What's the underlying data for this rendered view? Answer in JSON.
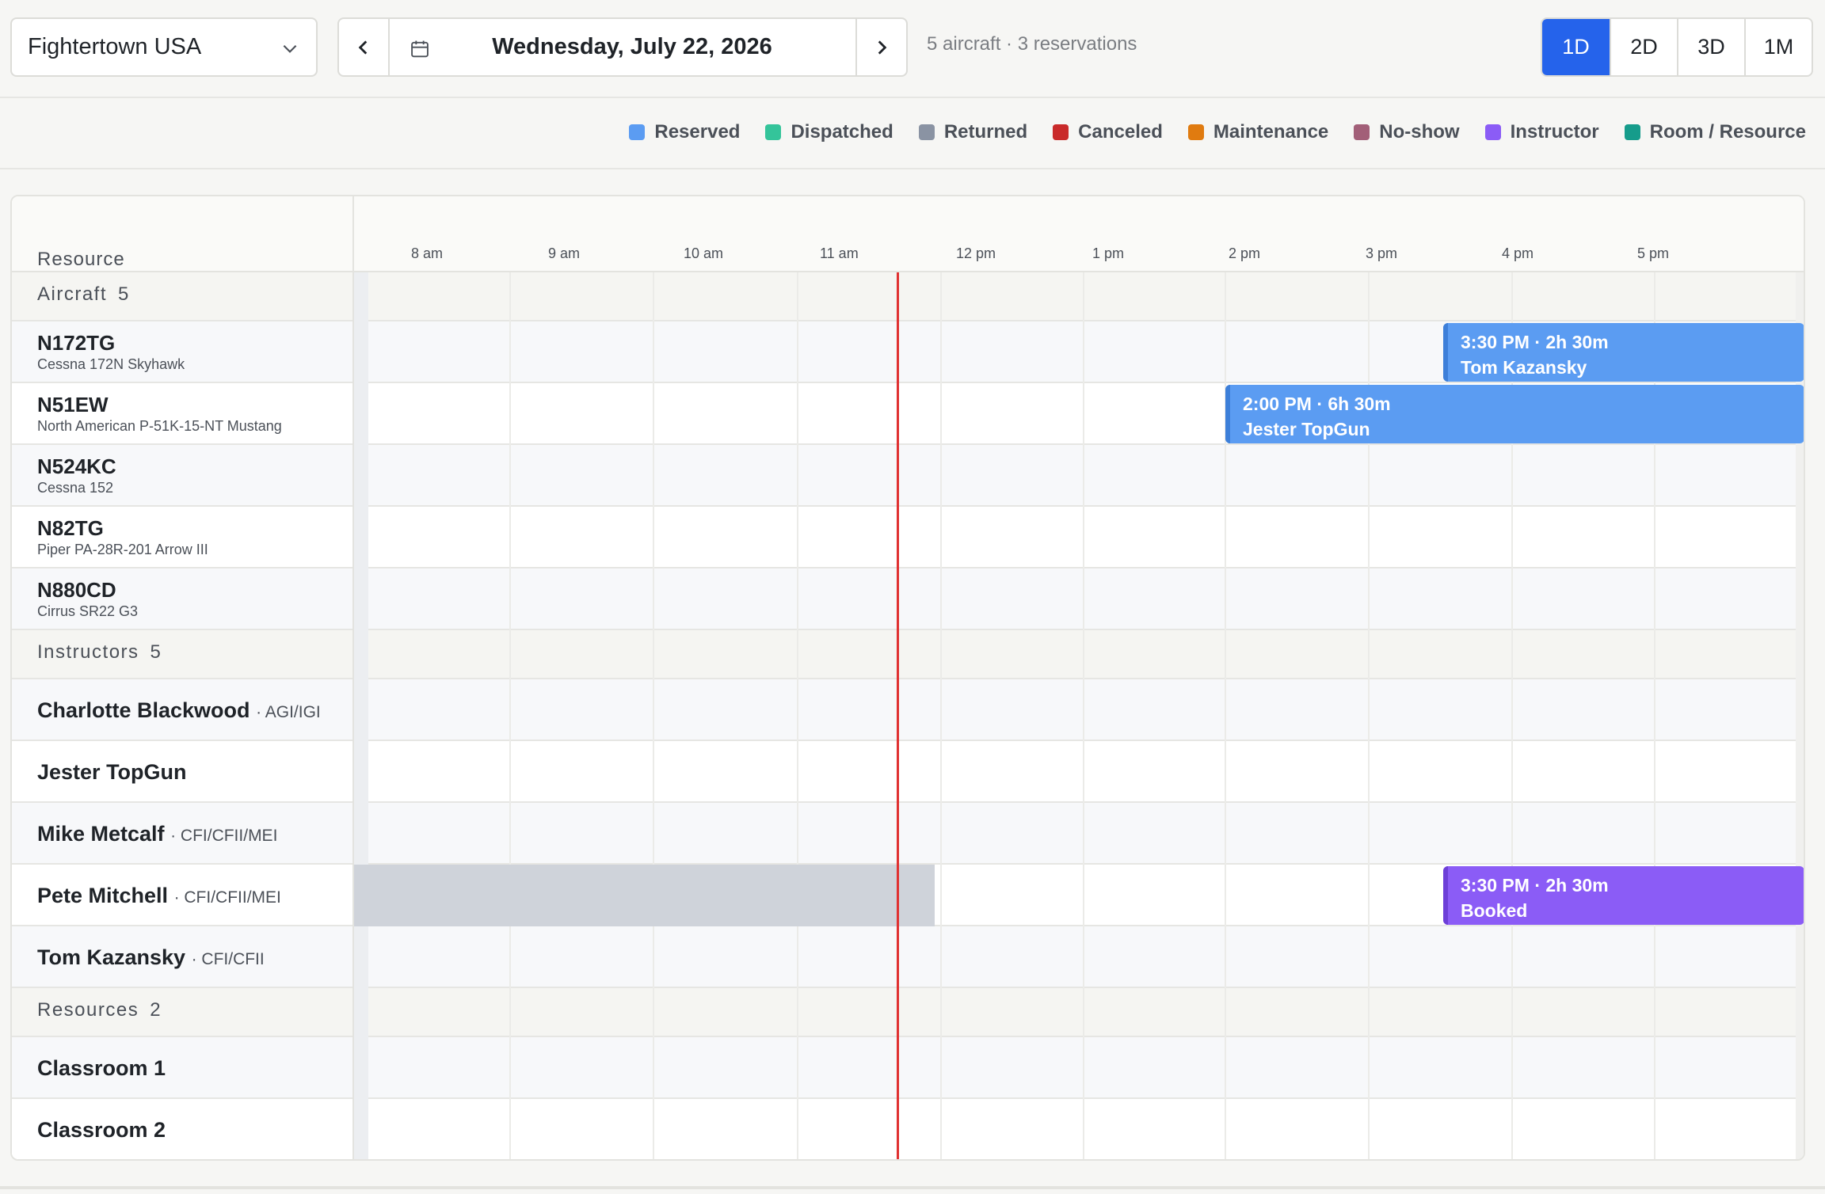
{
  "toolbar": {
    "location": "Fightertown USA",
    "date": "Wednesday, July 22, 2026",
    "summary": "5 aircraft · 3 reservations",
    "views": [
      "1D",
      "2D",
      "3D",
      "1M"
    ],
    "active_view": "1D"
  },
  "legend": [
    {
      "label": "Reserved",
      "color": "#5b9cf2"
    },
    {
      "label": "Dispatched",
      "color": "#34c49a"
    },
    {
      "label": "Returned",
      "color": "#8a93a3"
    },
    {
      "label": "Canceled",
      "color": "#c92a2a"
    },
    {
      "label": "Maintenance",
      "color": "#e07b10"
    },
    {
      "label": "No-show",
      "color": "#a25f78"
    },
    {
      "label": "Instructor",
      "color": "#8b5cf6"
    },
    {
      "label": "Room / Resource",
      "color": "#169c8b"
    }
  ],
  "grid": {
    "resource_header": "Resource",
    "hours": [
      "8 am",
      "9 am",
      "10 am",
      "11 am",
      "12 pm",
      "1 pm",
      "2 pm",
      "3 pm",
      "4 pm",
      "5 pm"
    ],
    "current_time": "11:30 AM",
    "groups": {
      "aircraft": {
        "label": "Aircraft",
        "count": "5"
      },
      "instructors": {
        "label": "Instructors",
        "count": "5"
      },
      "resources": {
        "label": "Resources",
        "count": "2"
      }
    },
    "aircraft": [
      {
        "tail": "N172TG",
        "model": "Cessna 172N Skyhawk"
      },
      {
        "tail": "N51EW",
        "model": "North American P-51K-15-NT Mustang"
      },
      {
        "tail": "N524KC",
        "model": "Cessna 152"
      },
      {
        "tail": "N82TG",
        "model": "Piper PA-28R-201 Arrow III"
      },
      {
        "tail": "N880CD",
        "model": "Cirrus SR22 G3"
      }
    ],
    "instructors": [
      {
        "name": "Charlotte Blackwood",
        "cert": "· AGI/IGI"
      },
      {
        "name": "Jester TopGun",
        "cert": ""
      },
      {
        "name": "Mike Metcalf",
        "cert": "· CFI/CFII/MEI"
      },
      {
        "name": "Pete Mitchell",
        "cert": "· CFI/CFII/MEI"
      },
      {
        "name": "Tom Kazansky",
        "cert": "· CFI/CFII"
      }
    ],
    "resources": [
      {
        "name": "Classroom 1"
      },
      {
        "name": "Classroom 2"
      }
    ],
    "events": [
      {
        "row": "N172TG",
        "time": "3:30 PM · 2h 30m",
        "label": "Tom Kazansky",
        "status": "Reserved"
      },
      {
        "row": "N51EW",
        "time": "2:00 PM · 6h 30m",
        "label": "Jester TopGun",
        "status": "Reserved"
      },
      {
        "row": "Pete Mitchell",
        "time": "3:30 PM · 2h 30m",
        "label": "Booked",
        "status": "Instructor"
      }
    ],
    "unavailable": [
      {
        "row": "Pete Mitchell",
        "start": "7:00 AM",
        "end": "12:00 PM"
      }
    ]
  }
}
